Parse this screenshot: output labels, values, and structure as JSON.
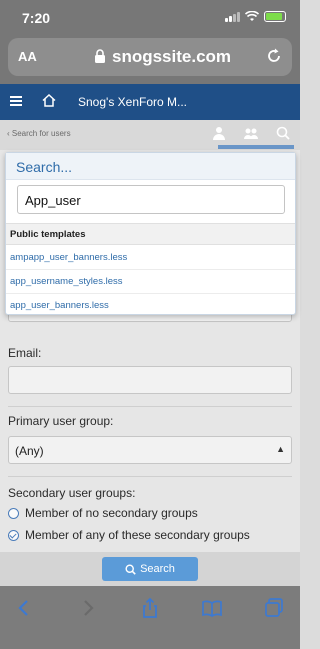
{
  "status_bar": {
    "time": "7:20"
  },
  "safari": {
    "text_size_label": "AA",
    "url": "snogssite.com"
  },
  "forum": {
    "title": "Snog's XenForo M...",
    "breadcrumb": "Search for users"
  },
  "form": {
    "email_label": "Email:",
    "primary_group_label": "Primary user group:",
    "primary_group_value": "(Any)",
    "secondary_groups_label": "Secondary user groups:",
    "secondary_options": [
      {
        "label": "Member of no secondary groups",
        "checked": false
      },
      {
        "label": "Member of any of these secondary groups",
        "checked": true
      }
    ],
    "search_button": "Search"
  },
  "dropdown": {
    "title": "Search...",
    "query": "App_user",
    "section_label": "Public templates",
    "results": [
      "ampapp_user_banners.less",
      "app_username_styles.less",
      "app_user_banners.less"
    ]
  },
  "icons": {
    "menu": "hamburger-icon",
    "home": "home-icon",
    "back": "chevron-left-icon",
    "forward": "chevron-right-icon",
    "share": "share-icon",
    "bookmarks": "book-icon",
    "tabs": "tabs-icon",
    "reload": "reload-icon",
    "lock": "lock-icon",
    "search": "search-icon"
  },
  "colors": {
    "forum_header": "#1f4f87",
    "link": "#2f6ca9",
    "button": "#5b9bd8"
  }
}
